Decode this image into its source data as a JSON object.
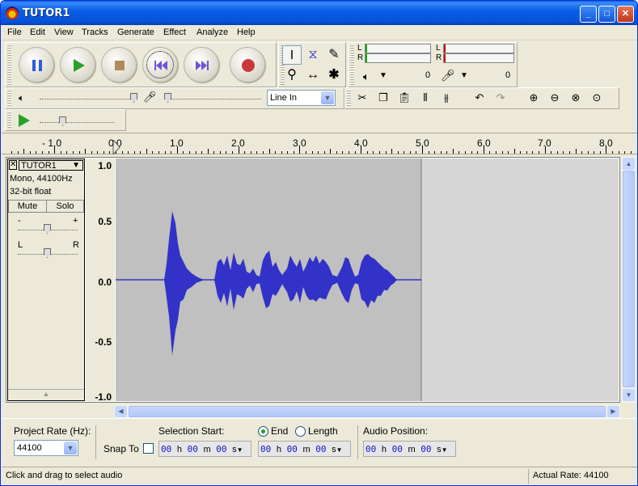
{
  "window": {
    "title": "TUTOR1"
  },
  "menu": [
    "File",
    "Edit",
    "View",
    "Tracks",
    "Generate",
    "Effect",
    "Analyze",
    "Help"
  ],
  "meters": {
    "play_l": "L",
    "play_r": "R",
    "rec_l": "L",
    "rec_r": "R",
    "play_val": "0",
    "rec_val": "0"
  },
  "input_source": "Line In",
  "ruler_labels": [
    "- 1.0",
    "0.0",
    "1.0",
    "2.0",
    "3.0",
    "4.0",
    "5.0",
    "6.0",
    "7.0",
    "8.0"
  ],
  "track": {
    "name": "TUTOR1",
    "format": "Mono, 44100Hz",
    "bitdepth": "32-bit float",
    "mute": "Mute",
    "solo": "Solo",
    "gain_minus": "-",
    "gain_plus": "+",
    "pan_left": "L",
    "pan_right": "R",
    "scale": [
      "1.0",
      "0.5",
      "0.0",
      "-0.5",
      "-1.0"
    ]
  },
  "bottom": {
    "project_rate_label": "Project Rate (Hz):",
    "project_rate": "44100",
    "snap_to": "Snap To",
    "selection_start": "Selection Start:",
    "end_label": "End",
    "length_label": "Length",
    "audio_position": "Audio Position:"
  },
  "time": {
    "h": "00",
    "m": "00",
    "s": "00",
    "hu": "h",
    "mu": "m",
    "su": "s"
  },
  "status": {
    "left": "Click and drag to select audio",
    "right": "Actual Rate: 44100"
  },
  "colors": {
    "wave": "#3232c8",
    "wave_bg": "#c0c0c0",
    "empty_bg": "#d6d6d6",
    "accent": "#0a5ce6"
  }
}
